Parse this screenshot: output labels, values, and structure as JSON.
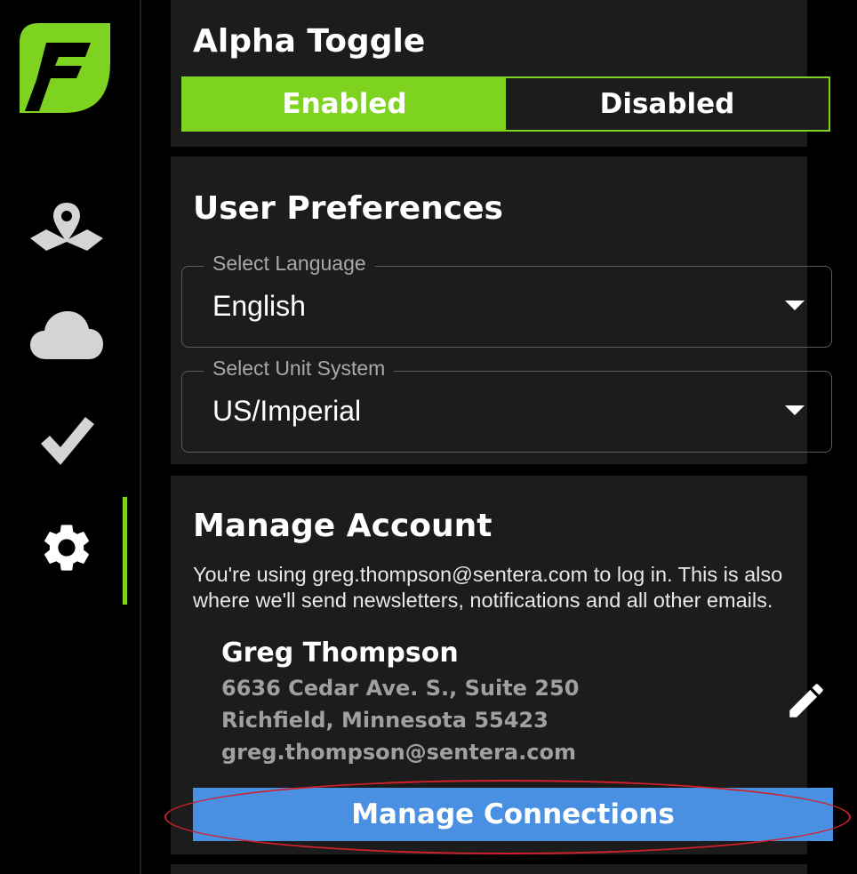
{
  "sidebar": {
    "logo": "sentera-logo",
    "items": [
      {
        "icon": "map-pin-icon",
        "active": false
      },
      {
        "icon": "cloud-icon",
        "active": false
      },
      {
        "icon": "checkmark-icon",
        "active": false
      },
      {
        "icon": "gear-icon",
        "active": true
      }
    ]
  },
  "alpha_toggle": {
    "title": "Alpha Toggle",
    "enabled_label": "Enabled",
    "disabled_label": "Disabled",
    "selected": "Enabled"
  },
  "user_preferences": {
    "title": "User Preferences",
    "language": {
      "label": "Select Language",
      "value": "English"
    },
    "unit_system": {
      "label": "Select Unit System",
      "value": "US/Imperial"
    }
  },
  "manage_account": {
    "title": "Manage Account",
    "description": "You're using greg.thompson@sentera.com to log in. This is also where we'll send newsletters, notifications and all other emails.",
    "name": "Greg Thompson",
    "address_line1": "6636 Cedar Ave. S., Suite 250",
    "address_line2": "Richfield, Minnesota 55423",
    "email": "greg.thompson@sentera.com",
    "manage_connections_label": "Manage Connections"
  },
  "colors": {
    "accent_green": "#7ed321",
    "button_blue": "#4a90e2",
    "card_bg": "#1c1c1c",
    "highlight_red": "#d0202a"
  }
}
